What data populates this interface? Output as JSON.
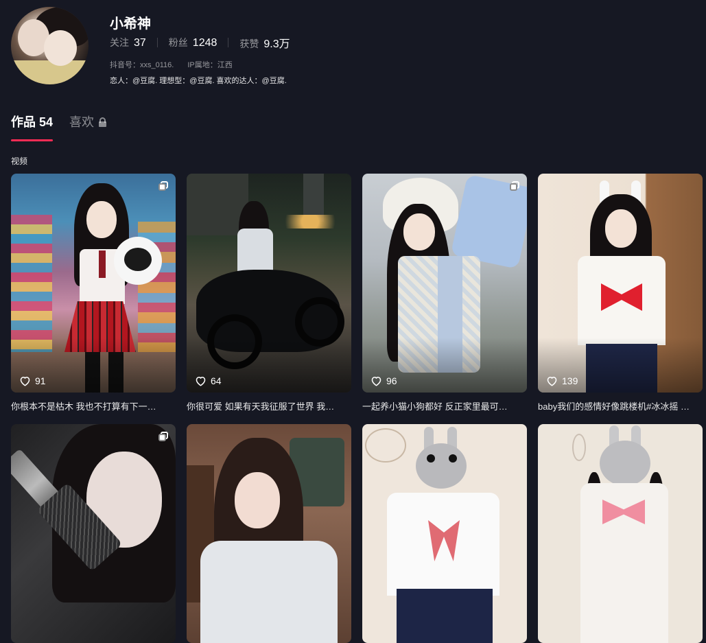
{
  "profile": {
    "name": "小希神",
    "stats": [
      {
        "label": "关注",
        "value": "37"
      },
      {
        "label": "粉丝",
        "value": "1248"
      },
      {
        "label": "获赞",
        "value": "9.3万"
      }
    ],
    "douyin_id": "抖音号：xxs_0116.",
    "ip_location": "IP属地：江西",
    "bio": "恋人：@豆腐. 理想型：@豆腐. 喜欢的达人：@豆腐."
  },
  "tabs": [
    {
      "label": "作品 54",
      "active": true
    },
    {
      "label": "喜欢",
      "active": false,
      "locked": true
    }
  ],
  "section_label": "视频",
  "videos": [
    {
      "likes": "91",
      "caption": "你根本不是枯木 我也不打算有下一…",
      "multi": true
    },
    {
      "likes": "64",
      "caption": "你很可爱 如果有天我征服了世界 我…",
      "multi": false
    },
    {
      "likes": "96",
      "caption": "一起养小猫小狗都好 反正家里最可…",
      "multi": true
    },
    {
      "likes": "139",
      "caption": "baby我们的感情好像跳楼机#冰冰摇 …",
      "multi": false
    },
    {
      "likes": "",
      "caption": "",
      "multi": true
    },
    {
      "likes": "",
      "caption": "",
      "multi": false
    },
    {
      "likes": "",
      "caption": "",
      "multi": false
    },
    {
      "likes": "",
      "caption": "",
      "multi": false
    }
  ],
  "colors": {
    "background": "#161823",
    "accent": "#fe2c55"
  },
  "icons": {
    "like": "heart-outline-icon",
    "multi_image": "stacked-images-icon",
    "lock": "lock-icon"
  }
}
